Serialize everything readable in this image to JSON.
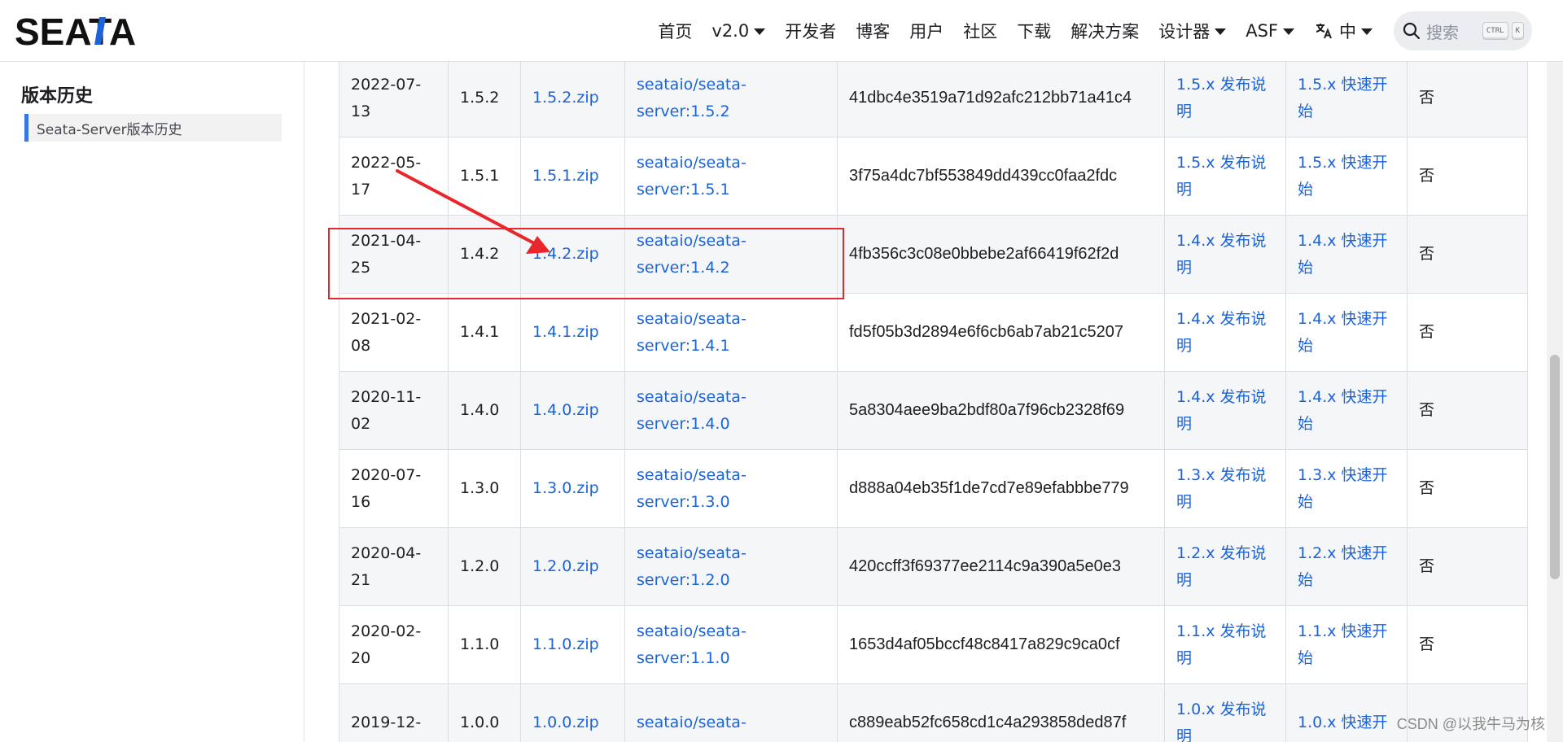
{
  "navbar": {
    "logo_text": "SEATA",
    "items": [
      {
        "label": "首页",
        "dropdown": false
      },
      {
        "label": "v2.0",
        "dropdown": true
      },
      {
        "label": "开发者",
        "dropdown": false
      },
      {
        "label": "博客",
        "dropdown": false
      },
      {
        "label": "用户",
        "dropdown": false
      },
      {
        "label": "社区",
        "dropdown": false
      },
      {
        "label": "下载",
        "dropdown": false
      },
      {
        "label": "解决方案",
        "dropdown": false
      },
      {
        "label": "设计器",
        "dropdown": true
      },
      {
        "label": "ASF",
        "dropdown": true
      }
    ],
    "language": {
      "label": "中",
      "icon": "translate-icon"
    },
    "search": {
      "placeholder": "搜索",
      "key1": "CTRL",
      "key2": "K",
      "icon": "search-icon"
    }
  },
  "sidebar": {
    "title": "版本历史",
    "items": [
      {
        "label": "Seata-Server版本历史",
        "active": true
      }
    ]
  },
  "table": {
    "rows": [
      {
        "date": "2022-07-13",
        "version": "1.5.2",
        "binary": "1.5.2.zip",
        "docker": "seataio/seata-server:1.5.2",
        "checksum": "41dbc4e3519a71d92afc212bb71a41c4",
        "release_notes": "1.5.x 发布说明",
        "quick_start": "1.5.x 快速开始",
        "flag": "否"
      },
      {
        "date": "2022-05-17",
        "version": "1.5.1",
        "binary": "1.5.1.zip",
        "docker": "seataio/seata-server:1.5.1",
        "checksum": "3f75a4dc7bf553849dd439cc0faa2fdc",
        "release_notes": "1.5.x 发布说明",
        "quick_start": "1.5.x 快速开始",
        "flag": "否"
      },
      {
        "date": "2021-04-25",
        "version": "1.4.2",
        "binary": "1.4.2.zip",
        "docker": "seataio/seata-server:1.4.2",
        "checksum": "4fb356c3c08e0bbebe2af66419f62f2d",
        "release_notes": "1.4.x 发布说明",
        "quick_start": "1.4.x 快速开始",
        "flag": "否"
      },
      {
        "date": "2021-02-08",
        "version": "1.4.1",
        "binary": "1.4.1.zip",
        "docker": "seataio/seata-server:1.4.1",
        "checksum": "fd5f05b3d2894e6f6cb6ab7ab21c5207",
        "release_notes": "1.4.x 发布说明",
        "quick_start": "1.4.x 快速开始",
        "flag": "否"
      },
      {
        "date": "2020-11-02",
        "version": "1.4.0",
        "binary": "1.4.0.zip",
        "docker": "seataio/seata-server:1.4.0",
        "checksum": "5a8304aee9ba2bdf80a7f96cb2328f69",
        "release_notes": "1.4.x 发布说明",
        "quick_start": "1.4.x 快速开始",
        "flag": "否"
      },
      {
        "date": "2020-07-16",
        "version": "1.3.0",
        "binary": "1.3.0.zip",
        "docker": "seataio/seata-server:1.3.0",
        "checksum": "d888a04eb35f1de7cd7e89efabbbe779",
        "release_notes": "1.3.x 发布说明",
        "quick_start": "1.3.x 快速开始",
        "flag": "否"
      },
      {
        "date": "2020-04-21",
        "version": "1.2.0",
        "binary": "1.2.0.zip",
        "docker": "seataio/seata-server:1.2.0",
        "checksum": "420ccff3f69377ee2114c9a390a5e0e3",
        "release_notes": "1.2.x 发布说明",
        "quick_start": "1.2.x 快速开始",
        "flag": "否"
      },
      {
        "date": "2020-02-20",
        "version": "1.1.0",
        "binary": "1.1.0.zip",
        "docker": "seataio/seata-server:1.1.0",
        "checksum": "1653d4af05bccf48c8417a829c9ca0cf",
        "release_notes": "1.1.x 发布说明",
        "quick_start": "1.1.x 快速开始",
        "flag": "否"
      },
      {
        "date": "2019-12-",
        "version": "1.0.0",
        "binary": "1.0.0.zip",
        "docker": "seataio/seata-",
        "checksum": "c889eab52fc658cd1c4a293858ded87f",
        "release_notes": "1.0.x 发布说明",
        "quick_start": "1.0.x 快速开",
        "flag": ""
      }
    ]
  },
  "annotation": {
    "color": "#e8262b"
  },
  "watermark": "CSDN @以我牛马为核",
  "colors": {
    "link": "#1a63d8",
    "accent": "#3578e5"
  }
}
